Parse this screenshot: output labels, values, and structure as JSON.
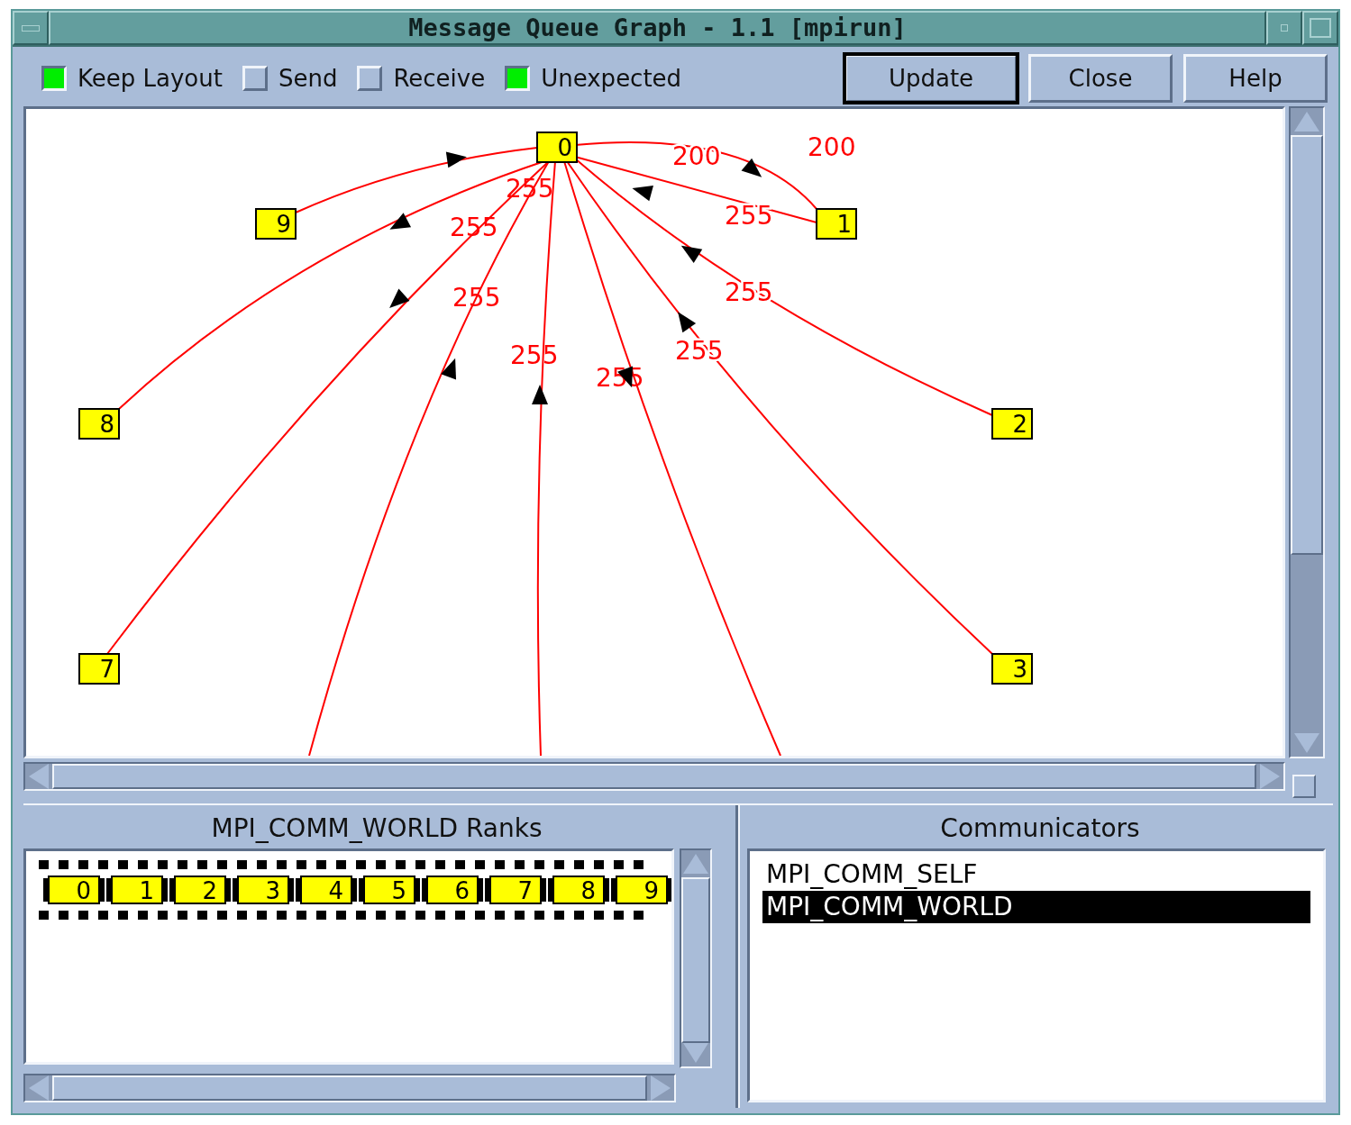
{
  "window": {
    "title": "Message Queue Graph - 1.1 [mpirun]"
  },
  "toolbar": {
    "checkboxes": [
      {
        "label": "Keep Layout",
        "checked": true
      },
      {
        "label": "Send",
        "checked": false
      },
      {
        "label": "Receive",
        "checked": false
      },
      {
        "label": "Unexpected",
        "checked": true
      }
    ],
    "buttons": [
      {
        "label": "Update",
        "selected": true
      },
      {
        "label": "Close",
        "selected": false
      },
      {
        "label": "Help",
        "selected": false
      }
    ]
  },
  "graph": {
    "nodes": [
      {
        "label": "0"
      },
      {
        "label": "1"
      },
      {
        "label": "9"
      },
      {
        "label": "8"
      },
      {
        "label": "7"
      },
      {
        "label": "2"
      },
      {
        "label": "3"
      }
    ],
    "edges": [
      {
        "incoming": true,
        "labels": [
          "255"
        ]
      },
      {
        "incoming": false,
        "labels": [
          "200",
          "200"
        ]
      },
      {
        "incoming": true,
        "labels": [
          "255"
        ]
      },
      {
        "incoming": false,
        "labels": [
          "255"
        ]
      },
      {
        "incoming": false,
        "labels": [
          "255"
        ]
      },
      {
        "incoming": true,
        "labels": [
          "255"
        ]
      },
      {
        "incoming": true,
        "labels": [
          "255"
        ]
      },
      {
        "incoming": false
      },
      {
        "incoming": true,
        "labels": [
          "255"
        ]
      },
      {
        "incoming": true,
        "labels": [
          "255"
        ]
      }
    ]
  },
  "ranks_panel": {
    "title": "MPI_COMM_WORLD Ranks",
    "ranks": [
      {
        "label": "0",
        "selected": true
      },
      {
        "label": "1",
        "selected": true
      },
      {
        "label": "2",
        "selected": true
      },
      {
        "label": "3",
        "selected": true
      },
      {
        "label": "4",
        "selected": true
      },
      {
        "label": "5",
        "selected": true
      },
      {
        "label": "6",
        "selected": true
      },
      {
        "label": "7",
        "selected": true
      },
      {
        "label": "8",
        "selected": true
      },
      {
        "label": "9",
        "selected": true
      }
    ]
  },
  "communicators_panel": {
    "title": "Communicators",
    "items": [
      {
        "label": "MPI_COMM_SELF",
        "selected": false
      },
      {
        "label": "MPI_COMM_WORLD",
        "selected": true
      }
    ]
  }
}
